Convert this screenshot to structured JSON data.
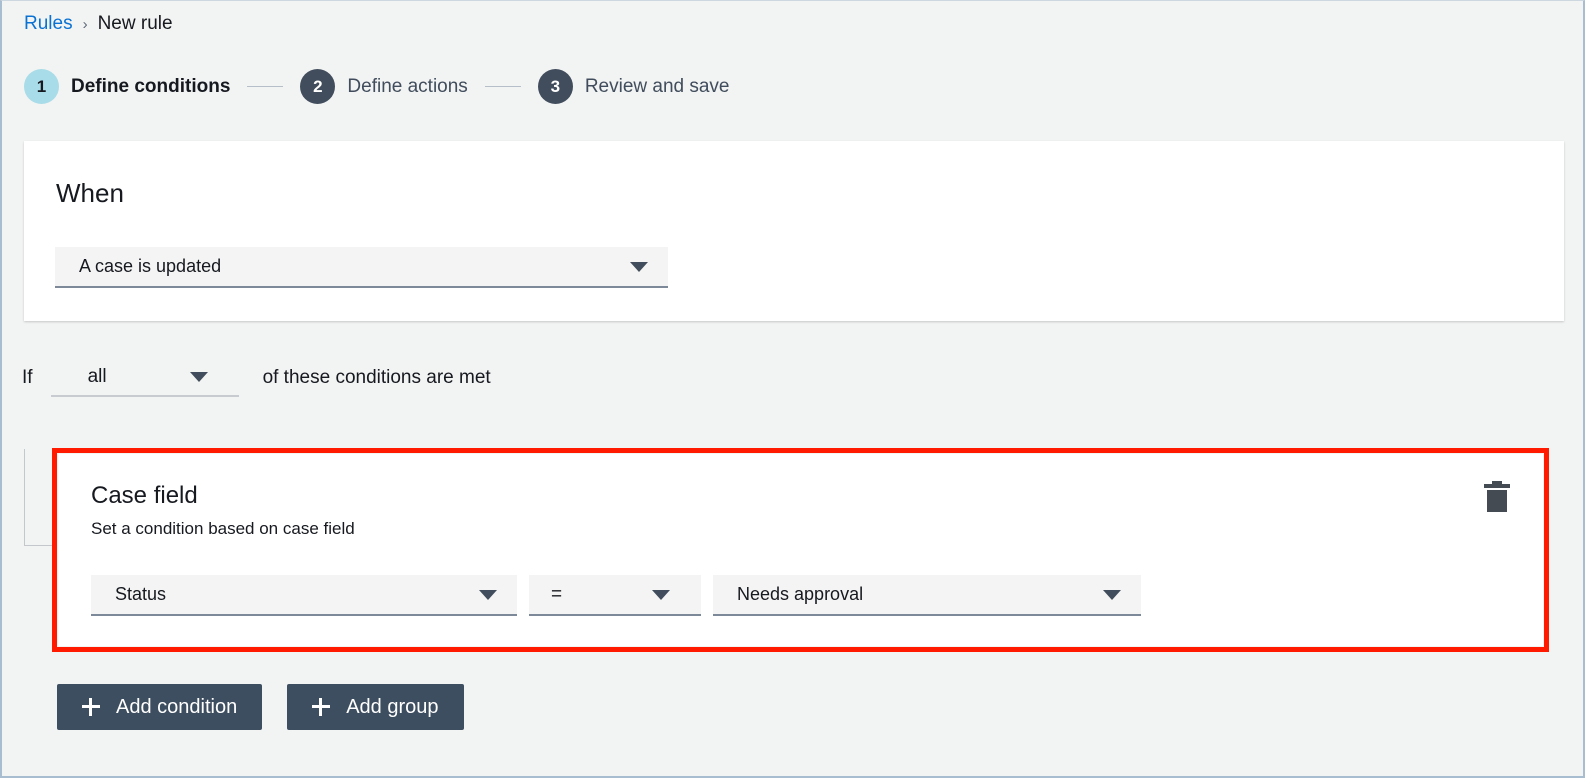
{
  "breadcrumb": {
    "link_label": "Rules",
    "separator": "›",
    "current_label": "New rule"
  },
  "stepper": {
    "steps": [
      {
        "number": "1",
        "label": "Define conditions",
        "state": "active"
      },
      {
        "number": "2",
        "label": "Define actions",
        "state": "inactive"
      },
      {
        "number": "3",
        "label": "Review and save",
        "state": "inactive"
      }
    ]
  },
  "when_card": {
    "title": "When",
    "trigger_select": {
      "value": "A case is updated",
      "icon": "chevron-down-icon"
    }
  },
  "if_row": {
    "prefix": "If",
    "match_select": {
      "value": "all",
      "icon": "chevron-down-icon"
    },
    "suffix": "of these conditions are met"
  },
  "condition_card": {
    "title": "Case field",
    "description": "Set a condition based on case field",
    "delete_icon": "trash-icon",
    "field_select": {
      "value": "Status",
      "icon": "chevron-down-icon"
    },
    "operator_select": {
      "value": "=",
      "icon": "chevron-down-icon"
    },
    "value_select": {
      "value": "Needs approval",
      "icon": "chevron-down-icon"
    }
  },
  "actions": {
    "add_condition_label": "Add condition",
    "add_group_label": "Add group",
    "plus_icon": "plus-icon"
  },
  "colors": {
    "highlight": "#ff1a00",
    "link": "#0972d3",
    "active_step": "#a8dce8",
    "inactive_step": "#414d5c",
    "button": "#3e4e61",
    "page_background": "#f2f3f3"
  }
}
